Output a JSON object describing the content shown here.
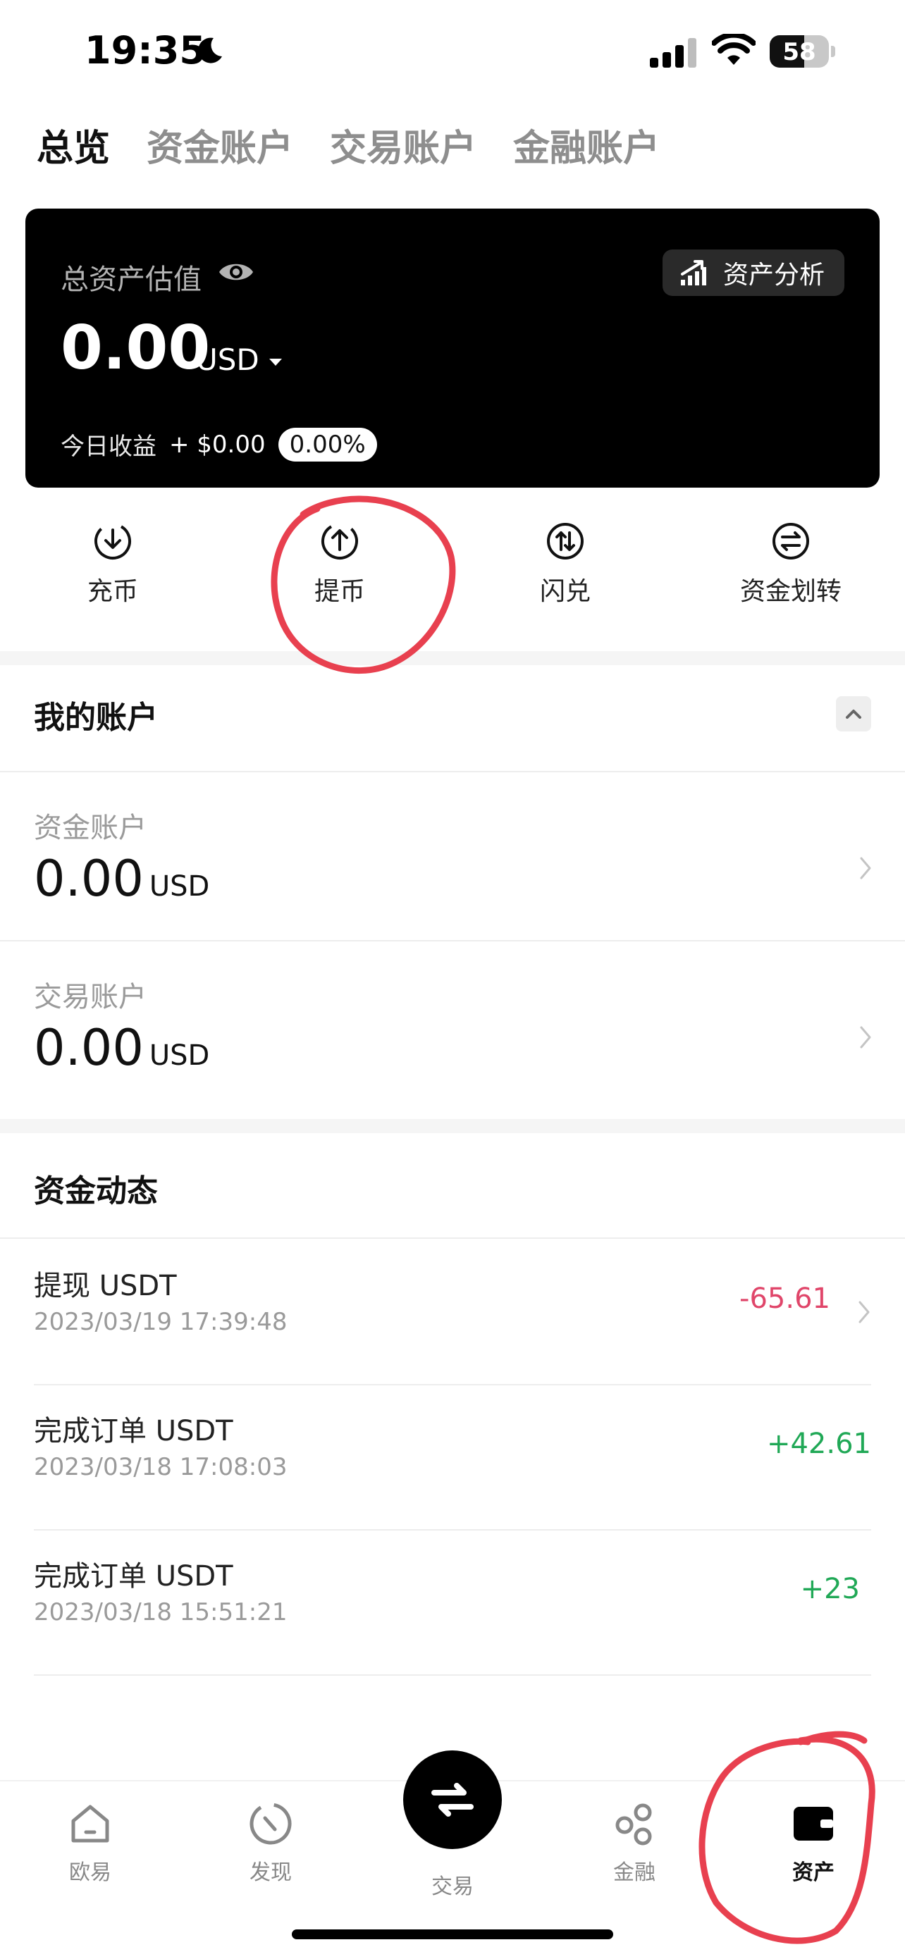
{
  "status_bar": {
    "time": "19:35",
    "battery": "58",
    "battery_level": 0.58
  },
  "tabs": [
    {
      "label": "总览",
      "active": true
    },
    {
      "label": "资金账户",
      "active": false
    },
    {
      "label": "交易账户",
      "active": false
    },
    {
      "label": "金融账户",
      "active": false
    }
  ],
  "summary": {
    "label": "总资产估值",
    "amount": "0.00",
    "currency": "USD",
    "analysis_button": "资产分析",
    "pnl_label": "今日收益",
    "pnl_value": "+ $0.00",
    "pnl_percent": "0.00%"
  },
  "actions": [
    {
      "label": "充币",
      "icon": "deposit-icon"
    },
    {
      "label": "提币",
      "icon": "withdraw-icon"
    },
    {
      "label": "闪兑",
      "icon": "swap-icon"
    },
    {
      "label": "资金划转",
      "icon": "transfer-icon"
    }
  ],
  "my_accounts": {
    "title": "我的账户",
    "items": [
      {
        "label": "资金账户",
        "amount": "0.00",
        "unit": "USD"
      },
      {
        "label": "交易账户",
        "amount": "0.00",
        "unit": "USD"
      }
    ]
  },
  "fund_activity": {
    "title": "资金动态",
    "items": [
      {
        "title": "提现 USDT",
        "time": "2023/03/19 17:39:48",
        "value": "-65.61",
        "sign": "negative"
      },
      {
        "title": "完成订单 USDT",
        "time": "2023/03/18 17:08:03",
        "value": "+42.61",
        "sign": "positive"
      },
      {
        "title": "完成订单 USDT",
        "time": "2023/03/18 15:51:21",
        "value": "+23",
        "sign": "positive"
      }
    ]
  },
  "bottom_nav": [
    {
      "label": "欧易",
      "icon": "home-icon"
    },
    {
      "label": "发现",
      "icon": "discover-icon"
    },
    {
      "label": "交易",
      "icon": "trade-swap-icon"
    },
    {
      "label": "金融",
      "icon": "finance-icon"
    },
    {
      "label": "资产",
      "icon": "wallet-icon",
      "active": true
    }
  ],
  "colors": {
    "negative": "#e0466a",
    "positive": "#20a856",
    "annotation": "#e8404f"
  }
}
